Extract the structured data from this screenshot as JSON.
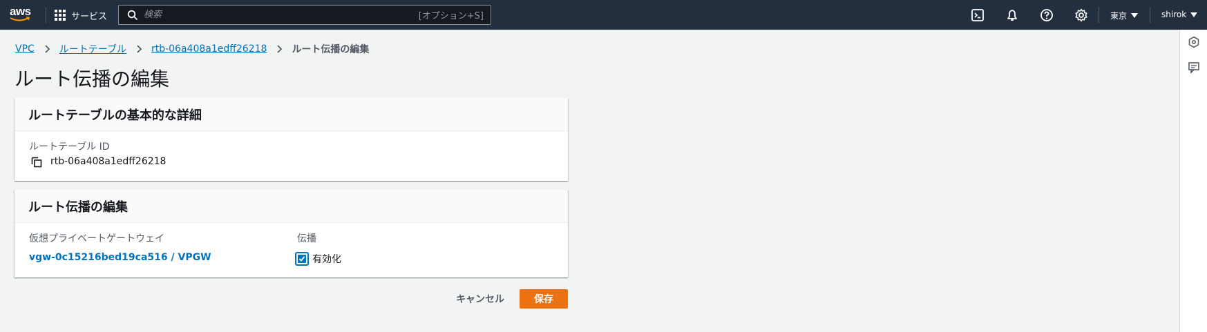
{
  "topnav": {
    "logo_text": "aws",
    "services_label": "サービス",
    "search_placeholder": "検索",
    "search_shortcut": "[オプション+S]",
    "region_label": "東京",
    "user_label": "shirok",
    "icons": [
      "cloudshell-icon",
      "bell-icon",
      "help-icon",
      "gear-icon"
    ]
  },
  "breadcrumb": {
    "items": [
      "VPC",
      "ルートテーブル",
      "rtb-06a408a1edff26218"
    ],
    "current": "ルート伝播の編集"
  },
  "page_title": "ルート伝播の編集",
  "details_panel": {
    "heading": "ルートテーブルの基本的な詳細",
    "route_table_id_label": "ルートテーブル ID",
    "route_table_id_value": "rtb-06a408a1edff26218"
  },
  "propagation_panel": {
    "heading": "ルート伝播の編集",
    "vgw_column_label": "仮想プライベートゲートウェイ",
    "propagation_column_label": "伝播",
    "vgw_link": "vgw-0c15216bed19ca516 / VPGW",
    "enabled_label": "有効化",
    "enabled_checked": true
  },
  "actions": {
    "cancel_label": "キャンセル",
    "save_label": "保存"
  },
  "colors": {
    "nav_bg": "#232f3e",
    "link": "#0073bb",
    "primary_button": "#ec7211",
    "page_bg": "#f2f3f3"
  }
}
